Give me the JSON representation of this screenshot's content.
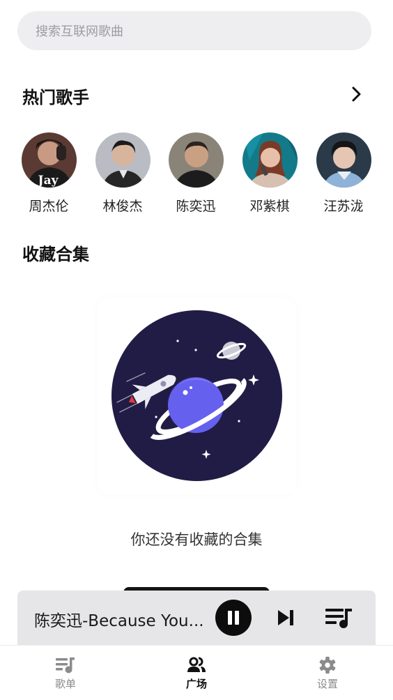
{
  "search": {
    "placeholder": "搜索互联网歌曲"
  },
  "hot_singers": {
    "title": "热门歌手",
    "more_icon": "chevron-right-icon",
    "singers": [
      {
        "name": "周杰伦",
        "avatar_caption": "Jay"
      },
      {
        "name": "林俊杰"
      },
      {
        "name": "陈奕迅"
      },
      {
        "name": "邓紫棋"
      },
      {
        "name": "汪苏泷"
      }
    ]
  },
  "favorites": {
    "title": "收藏合集",
    "empty_illustration": "planet-rocket-illustration",
    "empty_text": "你还没有收藏的合集"
  },
  "player": {
    "now_playing": "陈奕迅-Because You...",
    "pause_icon": "pause-icon",
    "next_icon": "skip-next-icon",
    "queue_icon": "playlist-icon"
  },
  "tabs": [
    {
      "label": "歌单",
      "icon": "playlist-icon",
      "active": false
    },
    {
      "label": "广场",
      "icon": "people-icon",
      "active": true
    },
    {
      "label": "设置",
      "icon": "gear-icon",
      "active": false
    }
  ],
  "colors": {
    "search_bg": "#eeeef0",
    "illustration_bg": "#211c45",
    "planet": "#6560ee",
    "player_bg": "#e6e6e8"
  }
}
